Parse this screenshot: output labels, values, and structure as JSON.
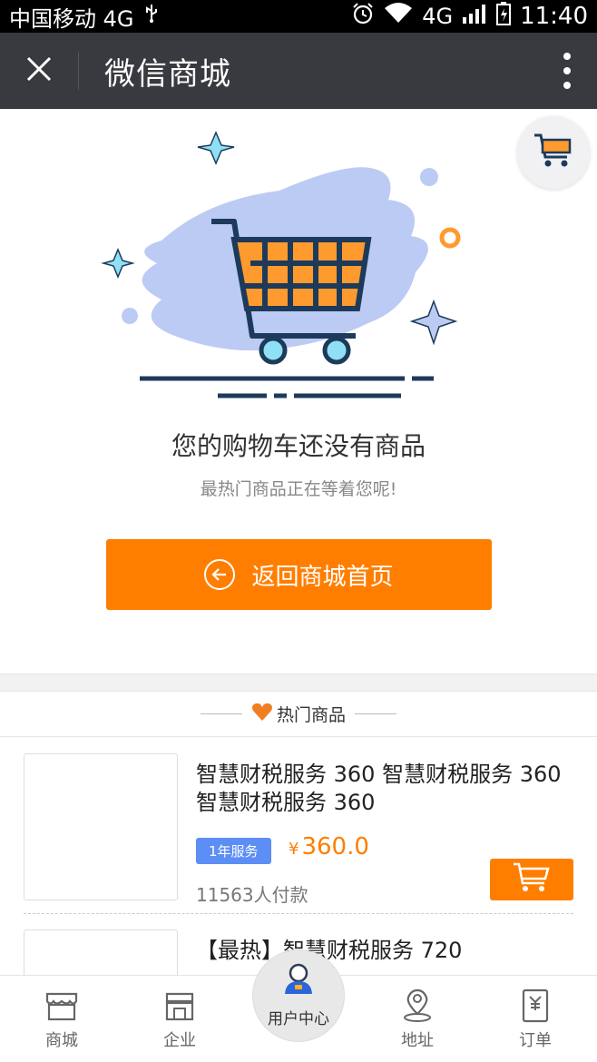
{
  "status_bar": {
    "carrier": "中国移动 4G",
    "network": "4G",
    "time": "11:40"
  },
  "header": {
    "title": "微信商城",
    "close_icon": "close-icon",
    "more_icon": "more-vertical-icon"
  },
  "empty": {
    "title": "您的购物车还没有商品",
    "subtitle": "最热门商品正在等着您呢!",
    "back_button": "返回商城首页"
  },
  "hot": {
    "label": "热门商品"
  },
  "products": [
    {
      "name": "智慧财税服务 360 智慧财税服务 360 智慧财税服务 360",
      "tag": "1年服务",
      "currency": "¥",
      "price": "360.0",
      "sold": "11563人付款"
    },
    {
      "name": "【最热】智慧财税服务 720"
    }
  ],
  "tabbar": {
    "items": [
      {
        "label": "商城",
        "icon": "shop-icon"
      },
      {
        "label": "企业",
        "icon": "store-icon"
      },
      {
        "label": "用户中心",
        "icon": "user-icon"
      },
      {
        "label": "地址",
        "icon": "location-icon"
      },
      {
        "label": "订单",
        "icon": "order-icon"
      }
    ]
  },
  "colors": {
    "accent": "#ff7e00",
    "header_bg": "#393a3f",
    "tag_bg": "#5c8ef5"
  }
}
